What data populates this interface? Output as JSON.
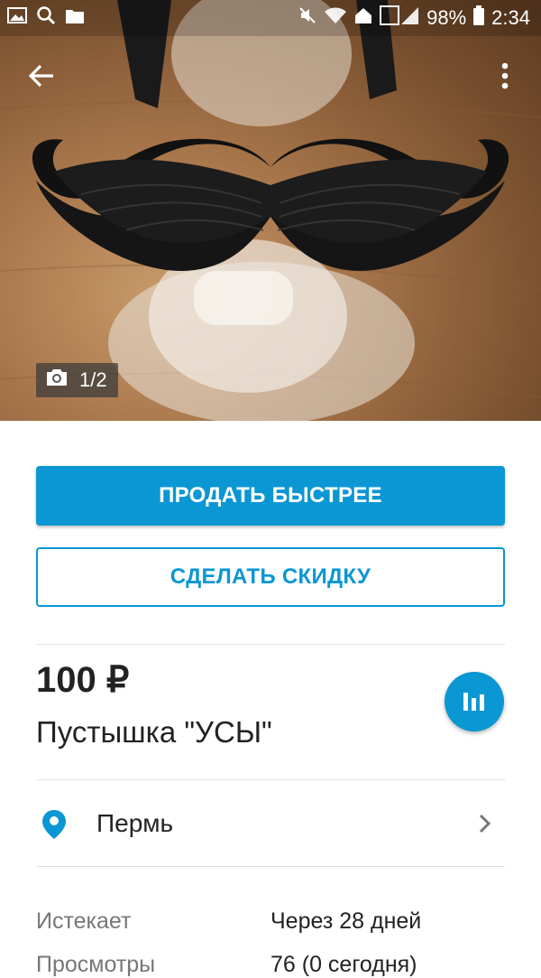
{
  "status_bar": {
    "battery": "98%",
    "time": "2:34"
  },
  "photo": {
    "counter": "1/2"
  },
  "actions": {
    "sell_faster": "ПРОДАТЬ БЫСТРЕЕ",
    "make_discount": "СДЕЛАТЬ СКИДКУ"
  },
  "listing": {
    "price": "100 ₽",
    "title": "Пустышка \"УСЫ\"",
    "location": "Пермь"
  },
  "details": [
    {
      "label": "Истекает",
      "value": "Через 28 дней"
    },
    {
      "label": "Просмотры",
      "value": "76 (0 сегодня)"
    }
  ],
  "colors": {
    "accent": "#0a97d4"
  },
  "icons": {
    "back": "arrow-left-icon",
    "menu": "more-vertical-icon",
    "camera": "camera-icon",
    "stats": "bar-chart-icon",
    "location": "location-pin-icon",
    "chevron": "chevron-right-icon"
  }
}
